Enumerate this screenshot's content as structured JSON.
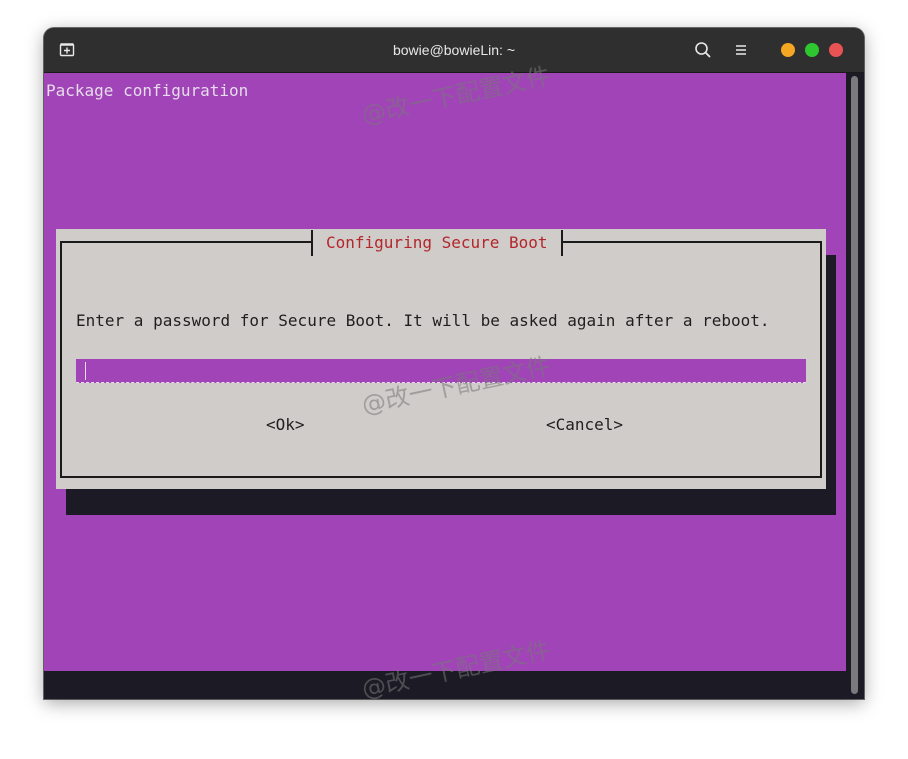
{
  "window": {
    "title": "bowie@bowieLin: ~"
  },
  "titlebar_icons": {
    "new_tab": "new-tab-icon",
    "search": "search-icon",
    "menu": "hamburger-menu-icon"
  },
  "window_controls": {
    "minimize_color": "#f5a623",
    "maximize_color": "#2ec730",
    "close_color": "#e95353"
  },
  "terminal": {
    "heading": "Package configuration",
    "background_color": "#a044b8"
  },
  "dialog": {
    "title": "Configuring Secure Boot",
    "prompt": "Enter a password for Secure Boot. It will be asked again after a reboot.",
    "password_value": "",
    "ok_label": "<Ok>",
    "cancel_label": "<Cancel>"
  },
  "watermark": {
    "text": "@改一下配置文件"
  }
}
